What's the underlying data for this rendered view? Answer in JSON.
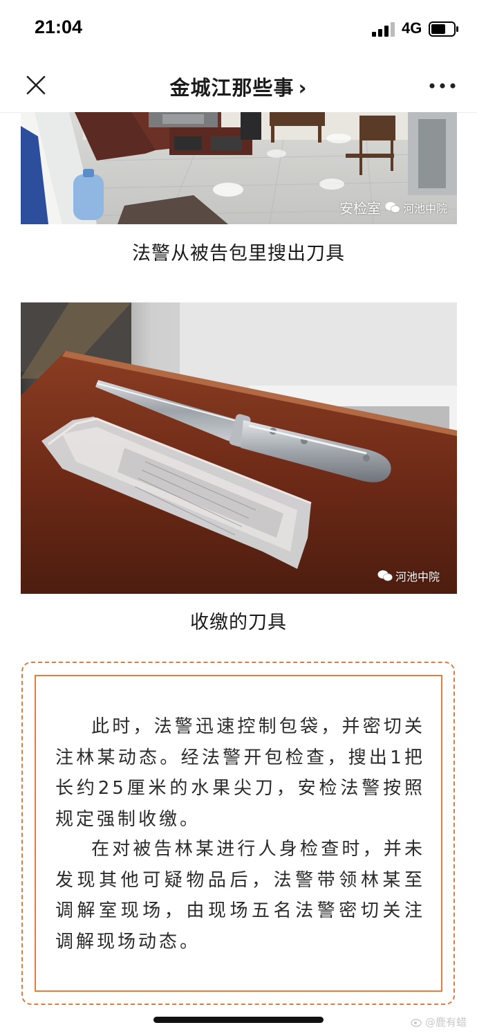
{
  "status_bar": {
    "time": "21:04",
    "network": "4G"
  },
  "nav": {
    "title": "金城江那些事",
    "chevron": "›",
    "close_icon": "close-icon",
    "more_icon": "more-dots-icon"
  },
  "images": [
    {
      "room_label": "安检室",
      "watermark": "河池中院"
    },
    {
      "watermark": "河池中院"
    }
  ],
  "captions": [
    "法警从被告包里搜出刀具",
    "收缴的刀具"
  ],
  "article": {
    "paragraphs": [
      "此时，法警迅速控制包袋，并密切关注林某动态。经法警开包检查，搜出1把长约25厘米的水果尖刀，安检法警按照规定强制收缴。",
      "在对被告林某进行人身检查时，并未发现其他可疑物品后，法警带领林某至调解室现场，由现场五名法警密切关注调解现场动态。"
    ]
  },
  "footer": {
    "weibo_mark": "@鹿有蜡"
  },
  "colors": {
    "accent_border": "#e07a3c",
    "text": "#2b2b2b"
  }
}
